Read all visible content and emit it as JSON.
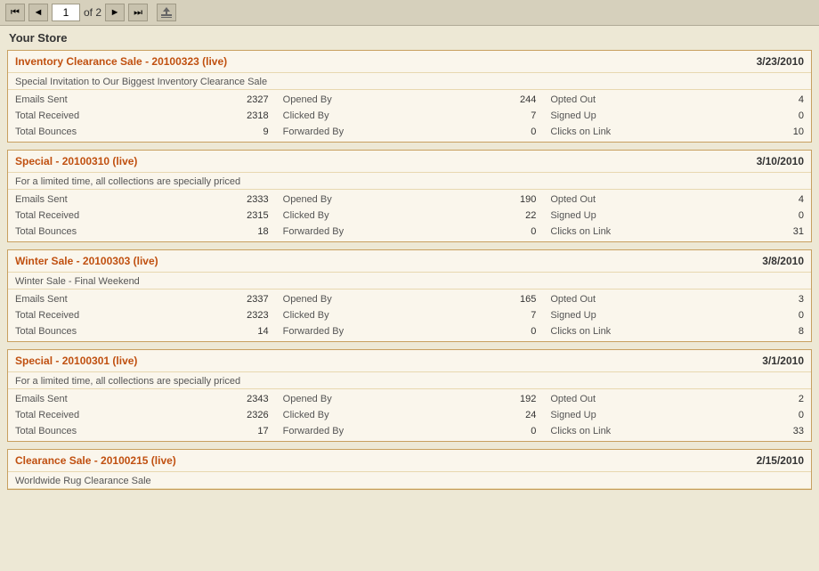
{
  "toolbar": {
    "page_current": "1",
    "page_total": "of 2"
  },
  "store": {
    "title": "Your Store"
  },
  "campaigns": [
    {
      "id": "c1",
      "title": "Inventory Clearance Sale - 20100323 (live)",
      "date": "3/23/2010",
      "subtitle": "Special Invitation to Our Biggest Inventory Clearance Sale",
      "stats": [
        {
          "label": "Emails Sent",
          "value": "2327",
          "label2": "Opened By",
          "value2": "244",
          "label3": "Opted Out",
          "value3": "4"
        },
        {
          "label": "Total Received",
          "value": "2318",
          "label2": "Clicked By",
          "value2": "7",
          "label3": "Signed Up",
          "value3": "0"
        },
        {
          "label": "Total Bounces",
          "value": "9",
          "label2": "Forwarded By",
          "value2": "0",
          "label3": "Clicks on Link",
          "value3": "10"
        }
      ]
    },
    {
      "id": "c2",
      "title": "Special - 20100310 (live)",
      "date": "3/10/2010",
      "subtitle": "For a limited time, all collections are specially priced",
      "stats": [
        {
          "label": "Emails Sent",
          "value": "2333",
          "label2": "Opened By",
          "value2": "190",
          "label3": "Opted Out",
          "value3": "4"
        },
        {
          "label": "Total Received",
          "value": "2315",
          "label2": "Clicked By",
          "value2": "22",
          "label3": "Signed Up",
          "value3": "0"
        },
        {
          "label": "Total Bounces",
          "value": "18",
          "label2": "Forwarded By",
          "value2": "0",
          "label3": "Clicks on Link",
          "value3": "31"
        }
      ]
    },
    {
      "id": "c3",
      "title": "Winter Sale - 20100303 (live)",
      "date": "3/8/2010",
      "subtitle": "Winter Sale - Final Weekend",
      "stats": [
        {
          "label": "Emails Sent",
          "value": "2337",
          "label2": "Opened By",
          "value2": "165",
          "label3": "Opted Out",
          "value3": "3"
        },
        {
          "label": "Total Received",
          "value": "2323",
          "label2": "Clicked By",
          "value2": "7",
          "label3": "Signed Up",
          "value3": "0"
        },
        {
          "label": "Total Bounces",
          "value": "14",
          "label2": "Forwarded By",
          "value2": "0",
          "label3": "Clicks on Link",
          "value3": "8"
        }
      ]
    },
    {
      "id": "c4",
      "title": "Special - 20100301 (live)",
      "date": "3/1/2010",
      "subtitle": "For a limited time, all collections are specially priced",
      "stats": [
        {
          "label": "Emails Sent",
          "value": "2343",
          "label2": "Opened By",
          "value2": "192",
          "label3": "Opted Out",
          "value3": "2"
        },
        {
          "label": "Total Received",
          "value": "2326",
          "label2": "Clicked By",
          "value2": "24",
          "label3": "Signed Up",
          "value3": "0"
        },
        {
          "label": "Total Bounces",
          "value": "17",
          "label2": "Forwarded By",
          "value2": "0",
          "label3": "Clicks on Link",
          "value3": "33"
        }
      ]
    },
    {
      "id": "c5",
      "title": "Clearance Sale - 20100215 (live)",
      "date": "2/15/2010",
      "subtitle": "Worldwide Rug Clearance Sale",
      "stats": []
    }
  ]
}
